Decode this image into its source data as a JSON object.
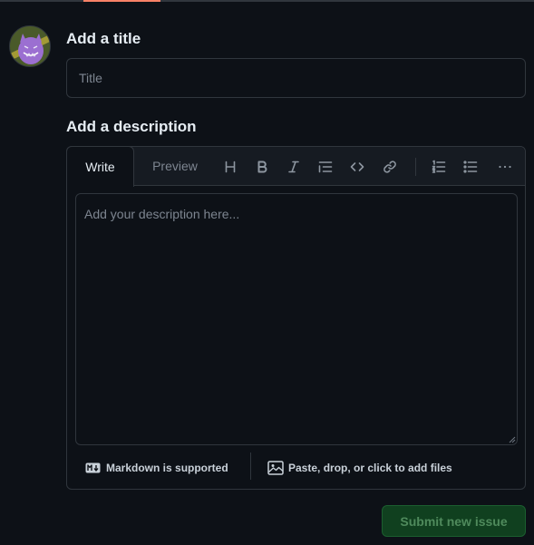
{
  "form": {
    "title_label": "Add a title",
    "title_input": {
      "value": "",
      "placeholder": "Title"
    },
    "description_label": "Add a description"
  },
  "editor": {
    "tabs": [
      {
        "label": "Write",
        "active": true
      },
      {
        "label": "Preview",
        "active": false
      }
    ],
    "toolbar": [
      {
        "icon": "heading-icon",
        "title": "Heading"
      },
      {
        "icon": "bold-icon",
        "title": "Bold"
      },
      {
        "icon": "italic-icon",
        "title": "Italic"
      },
      {
        "icon": "quote-icon",
        "title": "Quote"
      },
      {
        "icon": "code-icon",
        "title": "Code"
      },
      {
        "icon": "link-icon",
        "title": "Link"
      },
      {
        "icon": "ordered-list-icon",
        "title": "Numbered list"
      },
      {
        "icon": "unordered-list-icon",
        "title": "Unordered list"
      },
      {
        "icon": "kebab-horizontal-icon",
        "title": "More"
      }
    ],
    "description": {
      "value": "",
      "placeholder": "Add your description here..."
    },
    "footer": {
      "markdown_label": "Markdown is supported",
      "files_label": "Paste, drop, or click to add files"
    }
  },
  "actions": {
    "submit_label": "Submit new issue",
    "submit_enabled": false
  },
  "colors": {
    "background": "#0d1117",
    "border": "#30363d",
    "tab_accent": "#f78166",
    "submit_bg": "#10401f",
    "submit_text": "#4f8a5c"
  }
}
